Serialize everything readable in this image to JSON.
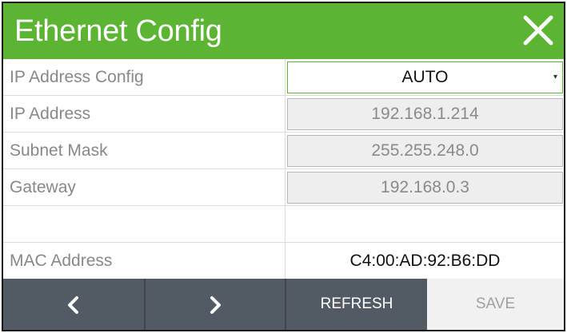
{
  "dialog": {
    "title": "Ethernet Config",
    "close_icon": "close-icon"
  },
  "fields": {
    "ip_config": {
      "label": "IP Address Config",
      "value": "AUTO"
    },
    "ip_address": {
      "label": "IP Address",
      "value": "192.168.1.214"
    },
    "subnet_mask": {
      "label": "Subnet Mask",
      "value": "255.255.248.0"
    },
    "gateway": {
      "label": "Gateway",
      "value": "192.168.0.3"
    },
    "mac_address": {
      "label": "MAC Address",
      "value": "C4:00:AD:92:B6:DD"
    }
  },
  "footer": {
    "prev_icon": "chevron-left-icon",
    "next_icon": "chevron-right-icon",
    "refresh_label": "REFRESH",
    "save_label": "SAVE"
  },
  "colors": {
    "header_green": "#5bb533",
    "footer_dark": "#525a64",
    "footer_light": "#f1f1f1"
  }
}
